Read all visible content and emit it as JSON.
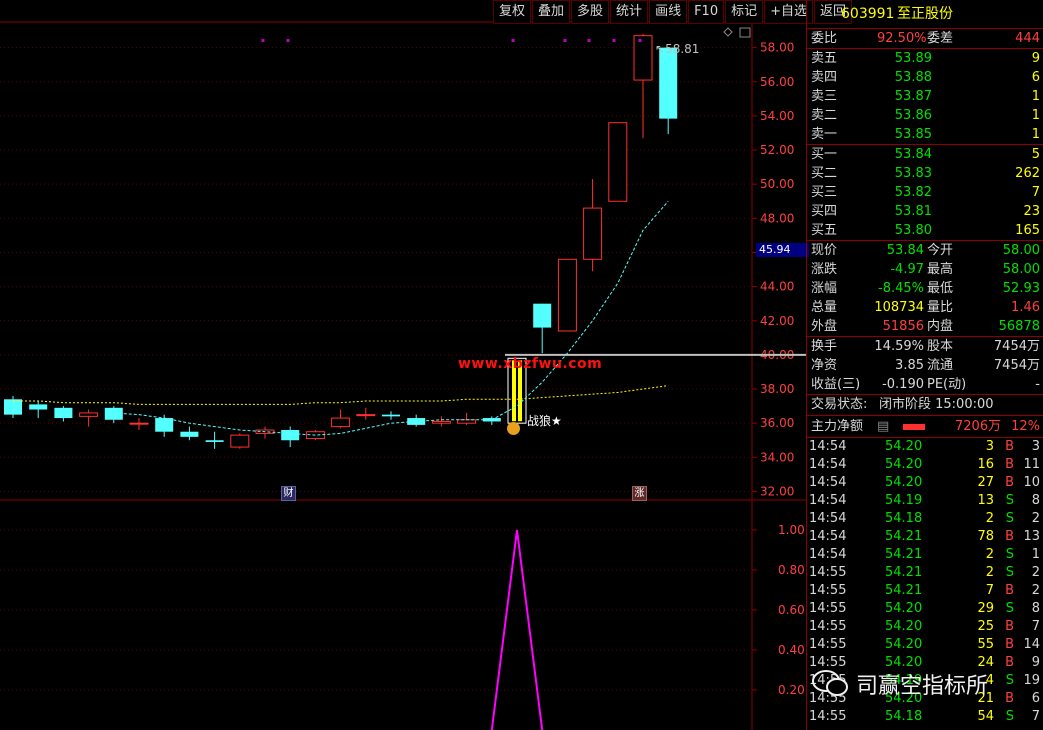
{
  "toolbar": {
    "buttons": [
      "复权",
      "叠加",
      "多股",
      "统计",
      "画线",
      "F10",
      "标记",
      "+自选",
      "返回"
    ]
  },
  "chart_data": {
    "type": "candlestick",
    "title": "",
    "ylim": [
      31.5,
      59.5
    ],
    "yticks": [
      "58.00",
      "56.00",
      "54.00",
      "52.00",
      "50.00",
      "48.00",
      "46.00",
      "44.00",
      "42.00",
      "40.00",
      "38.00",
      "36.00",
      "34.00",
      "32.00"
    ],
    "candles": [
      {
        "o": 37.4,
        "c": 36.5,
        "h": 37.6,
        "l": 36.3
      },
      {
        "o": 37.1,
        "c": 36.8,
        "h": 37.3,
        "l": 36.3
      },
      {
        "o": 36.9,
        "c": 36.3,
        "h": 37.0,
        "l": 36.1
      },
      {
        "o": 36.4,
        "c": 36.6,
        "h": 36.8,
        "l": 35.8
      },
      {
        "o": 36.9,
        "c": 36.2,
        "h": 37.0,
        "l": 36.0
      },
      {
        "o": 36.0,
        "c": 36.0,
        "h": 36.3,
        "l": 35.6
      },
      {
        "o": 36.3,
        "c": 35.5,
        "h": 36.5,
        "l": 35.2
      },
      {
        "o": 35.5,
        "c": 35.2,
        "h": 35.8,
        "l": 35.0
      },
      {
        "o": 35.0,
        "c": 34.9,
        "h": 35.5,
        "l": 34.5
      },
      {
        "o": 34.6,
        "c": 35.3,
        "h": 35.4,
        "l": 34.5
      },
      {
        "o": 35.4,
        "c": 35.6,
        "h": 35.8,
        "l": 35.1
      },
      {
        "o": 35.6,
        "c": 35.0,
        "h": 35.8,
        "l": 34.6
      },
      {
        "o": 35.1,
        "c": 35.5,
        "h": 35.6,
        "l": 35.0
      },
      {
        "o": 35.8,
        "c": 36.3,
        "h": 36.8,
        "l": 35.7
      },
      {
        "o": 36.5,
        "c": 36.5,
        "h": 36.9,
        "l": 36.2
      },
      {
        "o": 36.5,
        "c": 36.4,
        "h": 36.7,
        "l": 36.2
      },
      {
        "o": 36.3,
        "c": 35.9,
        "h": 36.5,
        "l": 35.8
      },
      {
        "o": 36.0,
        "c": 36.1,
        "h": 36.4,
        "l": 35.8
      },
      {
        "o": 36.0,
        "c": 36.2,
        "h": 36.6,
        "l": 35.9
      },
      {
        "o": 36.3,
        "c": 36.1,
        "h": 36.4,
        "l": 35.9
      },
      {
        "o": 36.0,
        "c": 39.8,
        "h": 39.8,
        "l": 36.0
      },
      {
        "o": 43.0,
        "c": 41.6,
        "h": 43.0,
        "l": 40.1
      },
      {
        "o": 41.4,
        "c": 45.6,
        "h": 45.6,
        "l": 41.4
      },
      {
        "o": 45.6,
        "c": 48.6,
        "h": 50.3,
        "l": 44.9
      },
      {
        "o": 49.0,
        "c": 53.6,
        "h": 53.6,
        "l": 49.0
      },
      {
        "o": 56.1,
        "c": 58.7,
        "h": 58.81,
        "l": 52.7
      },
      {
        "o": 58.0,
        "c": 53.84,
        "h": 58.0,
        "l": 52.93
      }
    ],
    "limit_up_bar": 20,
    "ma_short": [
      null,
      null,
      null,
      null,
      36.6,
      36.5,
      36.3,
      36.0,
      35.8,
      35.6,
      35.5,
      35.4,
      35.3,
      35.4,
      35.7,
      36.0,
      36.1,
      36.2,
      36.2,
      36.2,
      37.0,
      38.4,
      40.1,
      42.0,
      44.2,
      47.3,
      49.0
    ],
    "ma_long": [
      37.3,
      37.3,
      37.2,
      37.2,
      37.2,
      37.1,
      37.1,
      37.1,
      37.1,
      37.1,
      37.1,
      37.1,
      37.2,
      37.2,
      37.3,
      37.3,
      37.3,
      37.3,
      37.4,
      37.4,
      37.4,
      37.5,
      37.6,
      37.7,
      37.8,
      38.0,
      38.2
    ],
    "max_label": "58.81",
    "price_tag": "45.94",
    "sub_yticks": [
      "1.00",
      "0.80",
      "0.60",
      "0.40",
      "0.20"
    ],
    "sub_ylim": [
      0,
      1.1
    ],
    "sub_values": [
      0,
      0,
      0,
      0,
      0,
      0,
      0,
      0,
      0,
      0,
      0,
      0,
      0,
      0,
      0,
      0,
      0,
      0,
      0,
      0,
      1,
      0,
      0,
      0,
      0,
      0,
      0
    ],
    "event_labels": [
      "财",
      "涨"
    ],
    "annotation": "战狼★",
    "url_text": "www.xbzfwu.com"
  },
  "panel": {
    "code": "603991",
    "name": "至正股份",
    "weibi": {
      "label1": "委比",
      "v1": "92.50%",
      "label2": "委差",
      "v2": "444"
    },
    "sells": [
      {
        "label": "卖五",
        "price": "53.89",
        "vol": "9"
      },
      {
        "label": "卖四",
        "price": "53.88",
        "vol": "6"
      },
      {
        "label": "卖三",
        "price": "53.87",
        "vol": "1"
      },
      {
        "label": "卖二",
        "price": "53.86",
        "vol": "1"
      },
      {
        "label": "卖一",
        "price": "53.85",
        "vol": "1"
      }
    ],
    "buys": [
      {
        "label": "买一",
        "price": "53.84",
        "vol": "5"
      },
      {
        "label": "买二",
        "price": "53.83",
        "vol": "262"
      },
      {
        "label": "买三",
        "price": "53.82",
        "vol": "7"
      },
      {
        "label": "买四",
        "price": "53.81",
        "vol": "23"
      },
      {
        "label": "买五",
        "price": "53.80",
        "vol": "165"
      }
    ],
    "stats1": [
      {
        "l1": "现价",
        "v1": "53.84",
        "l2": "今开",
        "v2": "58.00"
      },
      {
        "l1": "涨跌",
        "v1": "-4.97",
        "l2": "最高",
        "v2": "58.00"
      },
      {
        "l1": "涨幅",
        "v1": "-8.45%",
        "l2": "最低",
        "v2": "52.93"
      },
      {
        "l1": "总量",
        "v1": "108734",
        "l2": "量比",
        "v2": "1.46"
      },
      {
        "l1": "外盘",
        "v1": "51856",
        "l2": "内盘",
        "v2": "56878"
      }
    ],
    "stats2": [
      {
        "l1": "换手",
        "v1": "14.59%",
        "l2": "股本",
        "v2": "7454万"
      },
      {
        "l1": "净资",
        "v1": "3.85",
        "l2": "流通",
        "v2": "7454万"
      },
      {
        "l1": "收益(三)",
        "v1": "-0.190",
        "l2": "PE(动)",
        "v2": "-"
      }
    ],
    "status_label": "交易状态:",
    "status_value": "闭市阶段 15:00:00",
    "main_flow_label": "主力净额",
    "main_flow_value": "7206万",
    "main_flow_pct": "12%",
    "ticks": [
      {
        "t": "14:54",
        "p": "54.20",
        "v": "3",
        "bs": "B",
        "n": "3"
      },
      {
        "t": "14:54",
        "p": "54.20",
        "v": "16",
        "bs": "B",
        "n": "11"
      },
      {
        "t": "14:54",
        "p": "54.20",
        "v": "27",
        "bs": "B",
        "n": "10"
      },
      {
        "t": "14:54",
        "p": "54.19",
        "v": "13",
        "bs": "S",
        "n": "8"
      },
      {
        "t": "14:54",
        "p": "54.18",
        "v": "2",
        "bs": "S",
        "n": "2"
      },
      {
        "t": "14:54",
        "p": "54.21",
        "v": "78",
        "bs": "B",
        "n": "13"
      },
      {
        "t": "14:54",
        "p": "54.21",
        "v": "2",
        "bs": "S",
        "n": "1"
      },
      {
        "t": "14:55",
        "p": "54.21",
        "v": "2",
        "bs": "S",
        "n": "2"
      },
      {
        "t": "14:55",
        "p": "54.21",
        "v": "7",
        "bs": "B",
        "n": "2"
      },
      {
        "t": "14:55",
        "p": "54.20",
        "v": "29",
        "bs": "S",
        "n": "8"
      },
      {
        "t": "14:55",
        "p": "54.20",
        "v": "25",
        "bs": "B",
        "n": "7"
      },
      {
        "t": "14:55",
        "p": "54.20",
        "v": "55",
        "bs": "B",
        "n": "14"
      },
      {
        "t": "14:55",
        "p": "54.20",
        "v": "24",
        "bs": "B",
        "n": "9"
      },
      {
        "t": "14:55",
        "p": "54.19",
        "v": "4",
        "bs": "S",
        "n": "19"
      },
      {
        "t": "14:55",
        "p": "54.20",
        "v": "21",
        "bs": "B",
        "n": "6"
      },
      {
        "t": "14:55",
        "p": "54.18",
        "v": "54",
        "bs": "S",
        "n": "7"
      }
    ]
  },
  "watermark": {
    "text": "司赢空指标所"
  },
  "colors": {
    "up": "#ff3030",
    "down": "#54ffff",
    "ma_short": "#54ffff",
    "ma_long": "#ffff00",
    "sub_line": "#ff00ff"
  }
}
